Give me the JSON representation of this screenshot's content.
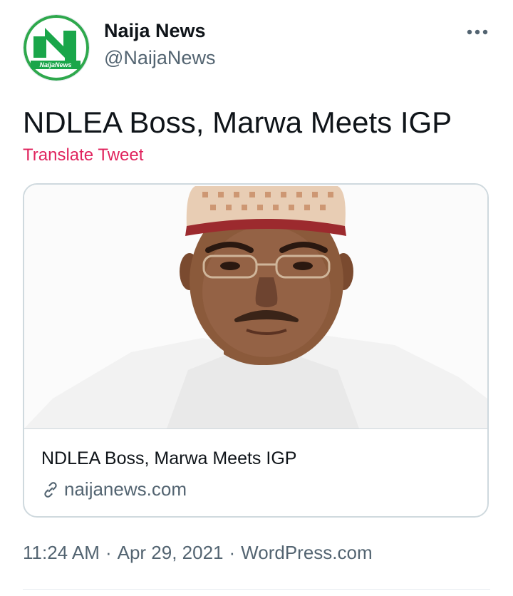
{
  "author": {
    "name": "Naija News",
    "handle": "@NaijaNews",
    "avatar_icon": "naija-news-logo-icon",
    "avatar_logo_text": "NaijaNews",
    "avatar_colors": {
      "green": "#1aa64a",
      "ring": "#2ea84c"
    }
  },
  "menu": {
    "icon": "more-options-icon"
  },
  "tweet": {
    "text": "NDLEA Boss, Marwa Meets IGP",
    "translate_label": "Translate Tweet",
    "translate_color": "#e0245e"
  },
  "card": {
    "image_icon": "portrait-photo",
    "title": "NDLEA Boss, Marwa Meets IGP",
    "domain": "naijanews.com",
    "link_icon": "link-icon"
  },
  "meta": {
    "time": "11:24 AM",
    "separator1": "·",
    "date": "Apr 29, 2021",
    "separator2": "·",
    "source": "WordPress.com"
  }
}
